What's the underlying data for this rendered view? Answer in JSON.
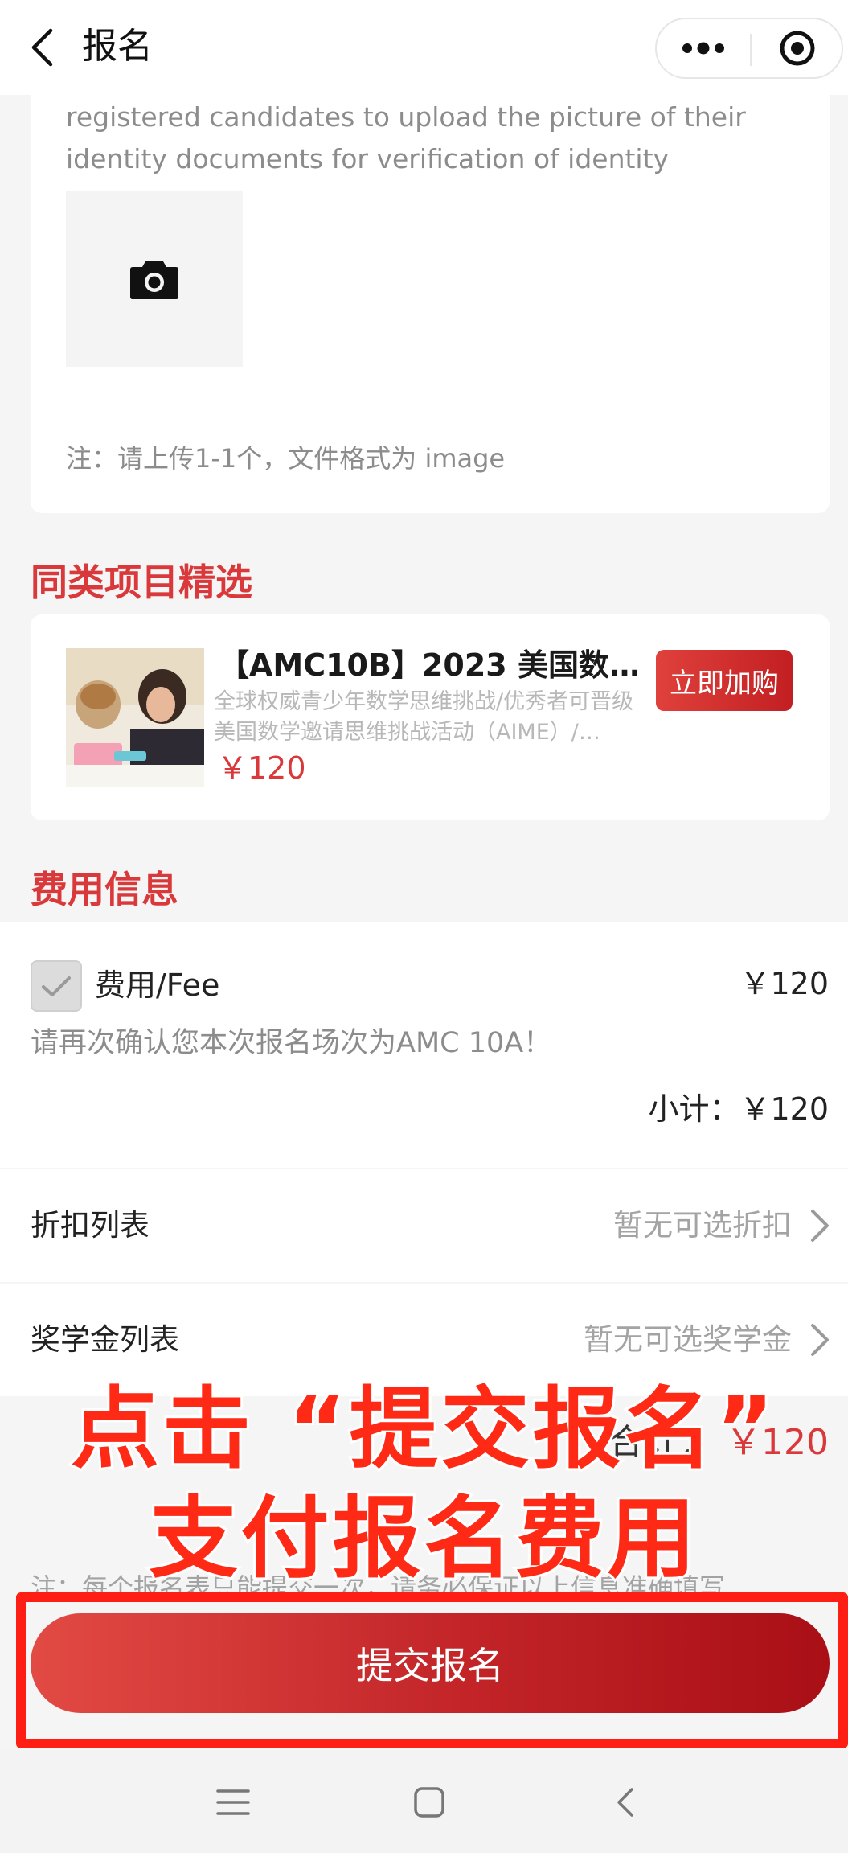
{
  "navbar": {
    "title": "报名",
    "back_icon": "back-arrow-icon",
    "more_icon": "more-dots-icon",
    "close_icon": "target-circle-icon"
  },
  "upload": {
    "description": "registered candidates to upload the picture of their identity documents for verification of identity",
    "camera_icon": "camera-icon",
    "note": "注：请上传1-1个，文件格式为 image"
  },
  "similar": {
    "section_title": "同类项目精选",
    "product": {
      "name": "【AMC10B】2023 美国数学…",
      "description": "全球权威青少年数学思维挑战/优秀者可晋级美国数学邀请思维挑战活动（AIME）/…",
      "price": "￥120",
      "buy_label": "立即加购"
    }
  },
  "fee": {
    "section_title": "费用信息",
    "item_label": "费用/Fee",
    "item_amount": "￥120",
    "confirm_text": "请再次确认您本次报名场次为AMC 10A！",
    "subtotal": "小计：￥120"
  },
  "discount": {
    "label": "折扣列表",
    "value": "暂无可选折扣"
  },
  "scholarship": {
    "label": "奖学金列表",
    "value": "暂无可选奖学金"
  },
  "total": {
    "label": "合计：",
    "amount": "￥120"
  },
  "bottom_note": "注：每个报名表只能提交一次，请务必保证以上信息准确填写",
  "overlay": {
    "line1": "点击 “提交报名”",
    "line2": "支付报名费用"
  },
  "submit": {
    "label": "提交报名"
  },
  "colors": {
    "accent": "#d9393a",
    "highlight": "#ff1e14",
    "overlay_text": "#ff2a16"
  }
}
